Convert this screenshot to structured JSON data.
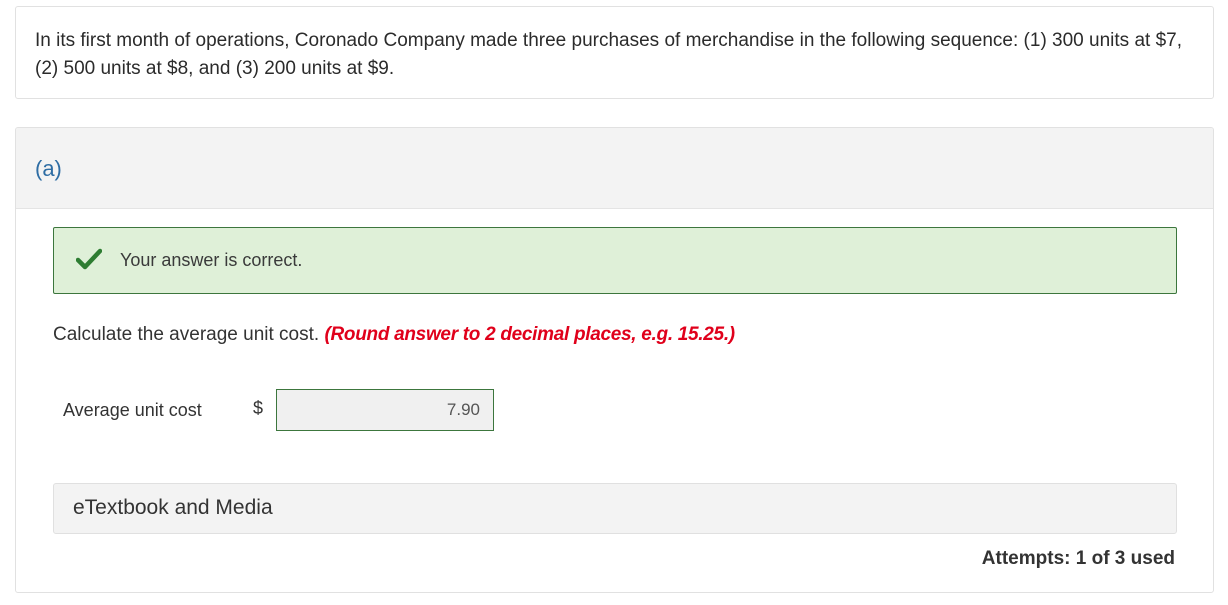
{
  "question": {
    "text": "In its first month of operations, Coronado Company made three purchases of merchandise in the following sequence: (1) 300 units at $7, (2) 500 units at $8, and (3) 200 units at $9."
  },
  "part": {
    "label": "(a)",
    "feedback": {
      "icon": "checkmark-icon",
      "text": "Your answer is correct.",
      "color": "#3c763d"
    },
    "instruction": "Calculate the average unit cost.",
    "hint": "(Round answer to 2 decimal places, e.g. 15.25.)",
    "answer": {
      "label": "Average unit cost",
      "currency": "$",
      "value": "7.90"
    },
    "etextbook_label": "eTextbook and Media",
    "attempts": "Attempts: 1 of 3 used"
  },
  "colors": {
    "accent_link": "#2e6da4",
    "success_bg": "#dff0d8",
    "hint_red": "#e0001b"
  }
}
